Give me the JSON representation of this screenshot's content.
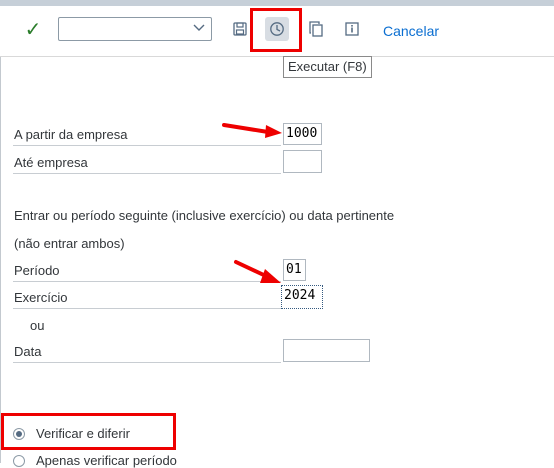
{
  "toolbar": {
    "check_icon": "checkmark-icon",
    "variant_value": "",
    "save_icon": "save-icon",
    "execute_icon": "clock-execute-icon",
    "copy_icon": "copy-icon",
    "info_icon": "info-icon",
    "cancel_label": "Cancelar",
    "tooltip": "Executar   (F8)"
  },
  "form": {
    "from_company_label": "A partir da empresa",
    "from_company_value": "1000",
    "to_company_label": "Até empresa",
    "to_company_value": "",
    "instruction_line1": "Entrar ou período seguinte (inclusive exercício) ou data pertinente",
    "instruction_line2": "(não entrar ambos)",
    "period_label": "Período",
    "period_value": "01",
    "fiscal_year_label": "Exercício",
    "fiscal_year_value": "2024",
    "or_label": "ou",
    "date_label": "Data",
    "date_value": ""
  },
  "options": {
    "verify_defer_label": "Verificar e diferir",
    "verify_only_label": "Apenas verificar período",
    "selected": "verify_defer"
  },
  "colors": {
    "highlight": "#ee0000",
    "link": "#0a6ed1",
    "check": "#2b7d2b"
  }
}
